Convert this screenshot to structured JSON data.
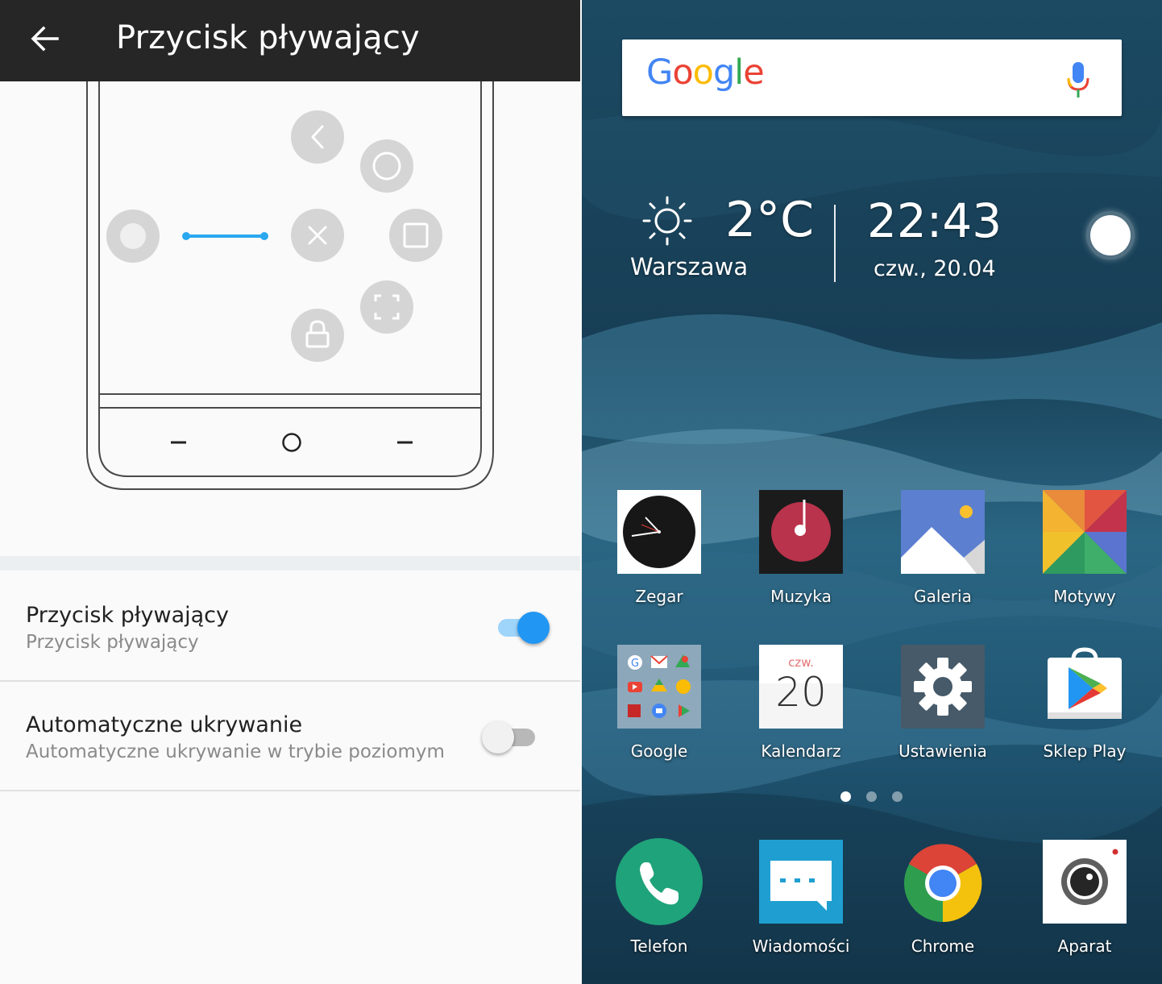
{
  "settings": {
    "title": "Przycisk pływający",
    "options": [
      {
        "title": "Przycisk pływający",
        "subtitle": "Przycisk pływający",
        "enabled": true
      },
      {
        "title": "Automatyczne ukrywanie",
        "subtitle": "Automatyczne ukrywanie w trybie poziomym",
        "enabled": false
      }
    ],
    "accent_color": "#2196f3"
  },
  "home": {
    "search": {
      "logo": "Google"
    },
    "weather": {
      "temperature": "2°C",
      "city": "Warszawa"
    },
    "clock": {
      "time": "22:43",
      "date": "czw., 20.04"
    },
    "apps": [
      {
        "label": "Zegar",
        "icon": "clock-icon"
      },
      {
        "label": "Muzyka",
        "icon": "music-icon"
      },
      {
        "label": "Galeria",
        "icon": "gallery-icon"
      },
      {
        "label": "Motywy",
        "icon": "themes-icon"
      },
      {
        "label": "Google",
        "icon": "google-folder-icon"
      },
      {
        "label": "Kalendarz",
        "icon": "calendar-icon",
        "badge_day": "czw.",
        "badge_date": "20"
      },
      {
        "label": "Ustawienia",
        "icon": "settings-gear-icon"
      },
      {
        "label": "Sklep Play",
        "icon": "play-store-icon"
      }
    ],
    "dock": [
      {
        "label": "Telefon",
        "icon": "phone-icon"
      },
      {
        "label": "Wiadomości",
        "icon": "messages-icon"
      },
      {
        "label": "Chrome",
        "icon": "chrome-icon"
      },
      {
        "label": "Aparat",
        "icon": "camera-icon"
      }
    ],
    "pages": {
      "count": 3,
      "current": 1
    }
  }
}
